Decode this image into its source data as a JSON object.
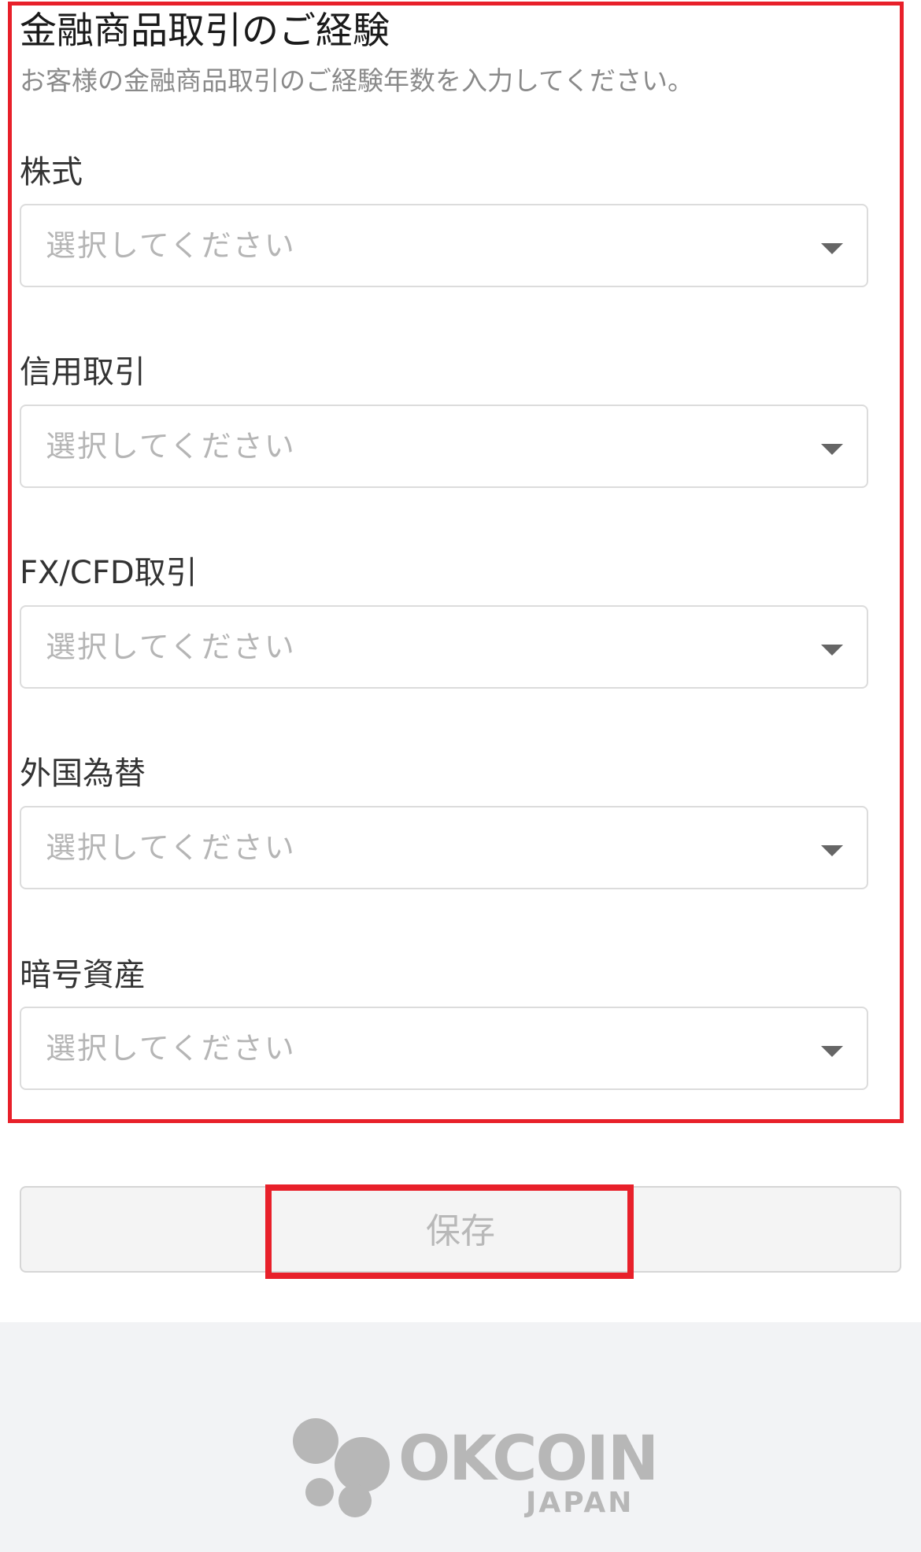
{
  "section": {
    "title": "金融商品取引のご経験",
    "subtitle": "お客様の金融商品取引のご経験年数を入力してください。"
  },
  "fields": [
    {
      "label": "株式",
      "placeholder": "選択してください"
    },
    {
      "label": "信用取引",
      "placeholder": "選択してください"
    },
    {
      "label": "FX/CFD取引",
      "placeholder": "選択してください"
    },
    {
      "label": "外国為替",
      "placeholder": "選択してください"
    },
    {
      "label": "暗号資産",
      "placeholder": "選択してください"
    }
  ],
  "save_button": {
    "label": "保存"
  },
  "footer": {
    "logo_word": "OKCOIN",
    "logo_sub": "JAPAN"
  },
  "colors": {
    "highlight": "#e8202a",
    "placeholder": "#b5b5b5",
    "footer_bg": "#f2f3f5",
    "logo": "#b7b7b7"
  },
  "icons": {
    "dropdown": "caret-down-icon",
    "logo": "okcoin-logo-icon"
  }
}
